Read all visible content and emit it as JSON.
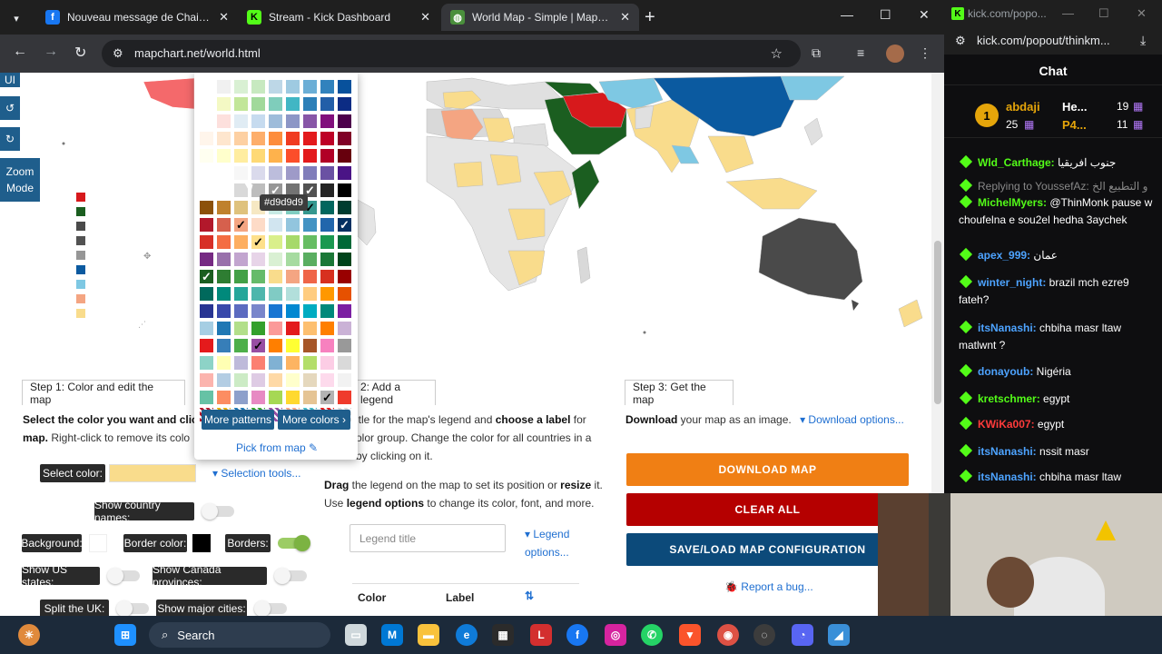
{
  "browser": {
    "tabs": [
      {
        "title": "Nouveau message de Chaima d",
        "icon": "facebook-icon",
        "color": "#1877f2"
      },
      {
        "title": "Stream - Kick Dashboard",
        "icon": "kick-icon",
        "color": "#53fc18"
      },
      {
        "title": "World Map - Simple | MapChar",
        "icon": "globe-icon",
        "color": "#4a8f3c"
      }
    ],
    "url": "mapchart.net/world.html"
  },
  "map_tools": {
    "ui_label": "UI",
    "zoom_label": "Zoom Mode"
  },
  "picker": {
    "tooltip": "#d9d9d9",
    "more_patterns": "More patterns",
    "more_colors": "More colors ›",
    "pick_from_map": "Pick from map ✎"
  },
  "step1": {
    "tab": "Step 1: Color and edit the map",
    "desc_bold": "Select the color you want and clic",
    "desc_rest_bold": "map.",
    "desc_rest": " Right-click to remove its colo",
    "select_color_label": "Select color:",
    "selected_color": "#f9dc8c",
    "selection_tools": "▾ Selection tools...",
    "show_country_names": "Show country names:",
    "background": "Background:",
    "border_color": "Border color:",
    "borders": "Borders:",
    "show_us_states": "Show US states:",
    "show_canada": "Show Canada provinces:",
    "split_uk": "Split the UK:",
    "show_major_cities": "Show major cities:"
  },
  "step2": {
    "tab": "2: Add a legend",
    "line1": "itle for the map's legend and ",
    "line1_bold": "choose a label",
    "line1_end": " for",
    "line2": "olor group. Change the color for all countries in a",
    "line3": "by clicking on it.",
    "drag_bold": "Drag",
    "drag_text": " the legend on the map to set its position or ",
    "resize_bold": "resize",
    "resize_end": " it.",
    "use_text": "Use ",
    "legend_options_bold": "legend options",
    "use_end": " to change its color, font, and more.",
    "legend_title_placeholder": "Legend title",
    "legend_options_link": "▾ Legend options...",
    "col_color": "Color",
    "col_label": "Label",
    "sort_icon": "⇅"
  },
  "step3": {
    "tab": "Step 3: Get the map",
    "download_bold": "Download",
    "download_text": " your map as an image.",
    "download_options": "▾ Download options...",
    "download_map": "DOWNLOAD MAP",
    "clear_all": "CLEAR ALL",
    "save_load": "SAVE/LOAD MAP CONFIGURATION",
    "report_bug": "🐞 Report a bug..."
  },
  "kick": {
    "window_title": "kick.com/popo...",
    "url": "kick.com/popout/thinkm...",
    "chat_title": "Chat",
    "leaderboard": [
      {
        "rank": "1",
        "name": "abdaji",
        "count": "25"
      },
      {
        "name": "He...",
        "count": "19"
      },
      {
        "name": "P4...",
        "count": "11"
      }
    ],
    "messages": [
      {
        "user": "Wld_Carthage:",
        "text": "جنوب افريقيا",
        "color": "#53fc18"
      },
      {
        "user": "Replying to YoussefAz:",
        "text": "و التطبيع الخ",
        "color": "#888888"
      },
      {
        "user": "MichelMyers:",
        "text": "@ThinMonk pause w choufelna e sou2el hedha 3aychek",
        "color": "#53fc18"
      },
      {
        "user": "apex_999:",
        "text": "عمان",
        "color": "#4da3ff"
      },
      {
        "user": "winter_night:",
        "text": "brazil mch ezre9 fateh?",
        "color": "#4da3ff"
      },
      {
        "user": "itsNanashi:",
        "text": "chbiha masr ltaw matlwnt ?",
        "color": "#4da3ff"
      },
      {
        "user": "donayoub:",
        "text": "Nigéria",
        "color": "#4da3ff"
      },
      {
        "user": "kretschmer:",
        "text": "egypt",
        "color": "#53fc18"
      },
      {
        "user": "KWiKa007:",
        "text": "egypt",
        "color": "#ff3b3b"
      },
      {
        "user": "itsNanashi:",
        "text": "nssit masr",
        "color": "#4da3ff"
      },
      {
        "user": "itsNanashi:",
        "text": "chbiha masr ltaw",
        "color": "#4da3ff"
      }
    ]
  },
  "taskbar": {
    "search": "Search"
  }
}
